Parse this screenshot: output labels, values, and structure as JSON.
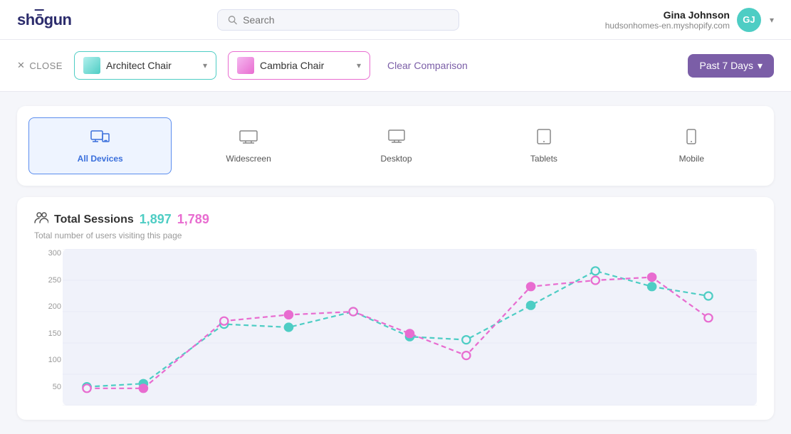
{
  "header": {
    "logo": "shōgun",
    "search_placeholder": "Search",
    "user_name": "Gina Johnson",
    "user_store": "hudsonhomes-en.myshopify.com",
    "user_initials": "GJ"
  },
  "toolbar": {
    "close_label": "CLOSE",
    "page1": {
      "label": "Architect Chair"
    },
    "page2": {
      "label": "Cambria Chair"
    },
    "clear_label": "Clear Comparison",
    "date_label": "Past 7 Days"
  },
  "device_tabs": [
    {
      "id": "all",
      "label": "All Devices",
      "icon": "▦",
      "active": true
    },
    {
      "id": "widescreen",
      "label": "Widescreen",
      "icon": "🖥",
      "active": false
    },
    {
      "id": "desktop",
      "label": "Desktop",
      "icon": "🖥",
      "active": false
    },
    {
      "id": "tablets",
      "label": "Tablets",
      "icon": "⬜",
      "active": false
    },
    {
      "id": "mobile",
      "label": "Mobile",
      "icon": "📱",
      "active": false
    }
  ],
  "chart": {
    "title": "Total Sessions",
    "val1": "1,897",
    "val2": "1,789",
    "subtitle": "Total number of users visiting this page",
    "y_labels": [
      "300",
      "250",
      "200",
      "150",
      "100",
      "50"
    ],
    "teal_color": "#4ecdc4",
    "pink_color": "#e86cd0"
  }
}
